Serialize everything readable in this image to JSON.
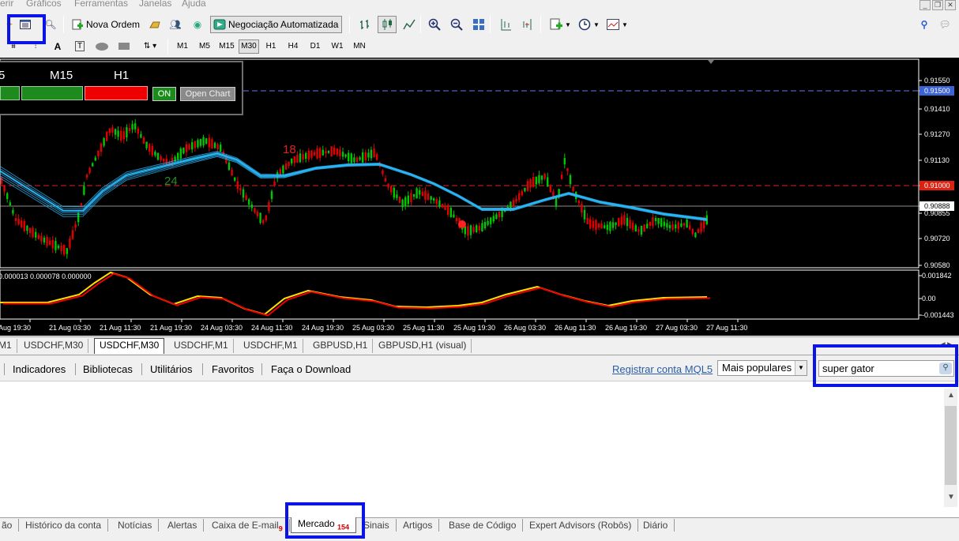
{
  "menu": [
    "erir",
    "Gráficos",
    "Ferramentas",
    "Janelas",
    "Ajuda"
  ],
  "toolbar": {
    "new_order": "Nova Ordem",
    "autotrading": "Negociação Automatizada"
  },
  "timeframes": [
    "M1",
    "M5",
    "M15",
    "M30",
    "H1",
    "H4",
    "D1",
    "W1",
    "MN"
  ],
  "selected_timeframe": "M30",
  "trend_panel": {
    "labels": [
      "5",
      "M15",
      "H1"
    ],
    "on": "ON",
    "open_chart": "Open Chart"
  },
  "chart": {
    "symbol": "USDCHF,M30",
    "price_labels": [
      "0.91550",
      "0.91500",
      "0.91410",
      "0.91270",
      "0.91130",
      "0.91000",
      "0.90888",
      "0.90855",
      "0.90720",
      "0.90580"
    ],
    "highlight_prices": {
      "blue": "0.91500",
      "red": "0.91000",
      "current": "0.90888"
    },
    "annotations": [
      "18",
      "24"
    ],
    "indicator_header": "0.000013 0.000078 0.000000",
    "indicator_labels": [
      "0.001842",
      "0.00",
      "-0.001443"
    ],
    "time_labels": [
      "Aug 19:30",
      "21 Aug 03:30",
      "21 Aug 11:30",
      "21 Aug 19:30",
      "24 Aug 03:30",
      "24 Aug 11:30",
      "24 Aug 19:30",
      "25 Aug 03:30",
      "25 Aug 11:30",
      "25 Aug 19:30",
      "26 Aug 03:30",
      "26 Aug 11:30",
      "26 Aug 19:30",
      "27 Aug 03:30",
      "27 Aug 11:30"
    ]
  },
  "chart_tabs": [
    "M1",
    "USDCHF,M30",
    "USDCHF,M30",
    "USDCHF,M1",
    "USDCHF,M1",
    "GBPUSD,H1",
    "GBPUSD,H1 (visual)"
  ],
  "market_panel": {
    "links": [
      "Indicadores",
      "Bibliotecas",
      "Utilitários",
      "Favoritos",
      "Faça o Download"
    ],
    "register": "Registrar conta MQL5",
    "sort": "Mais populares",
    "search": "super gator"
  },
  "bottom_tabs": [
    {
      "label": "ão"
    },
    {
      "label": "Histórico da conta"
    },
    {
      "label": "Notícias"
    },
    {
      "label": "Alertas"
    },
    {
      "label": "Caixa de E-mail",
      "badge": "9"
    },
    {
      "label": "Mercado",
      "badge": "154"
    },
    {
      "label": "Sinais"
    },
    {
      "label": "Artigos"
    },
    {
      "label": "Base de Código"
    },
    {
      "label": "Expert Advisors (Robôs)"
    },
    {
      "label": "Diário"
    }
  ],
  "colors": {
    "highlight": "#0a14e6",
    "candle_up": "#00c800",
    "candle_down": "#e00000",
    "ma": "#29b6f6"
  }
}
